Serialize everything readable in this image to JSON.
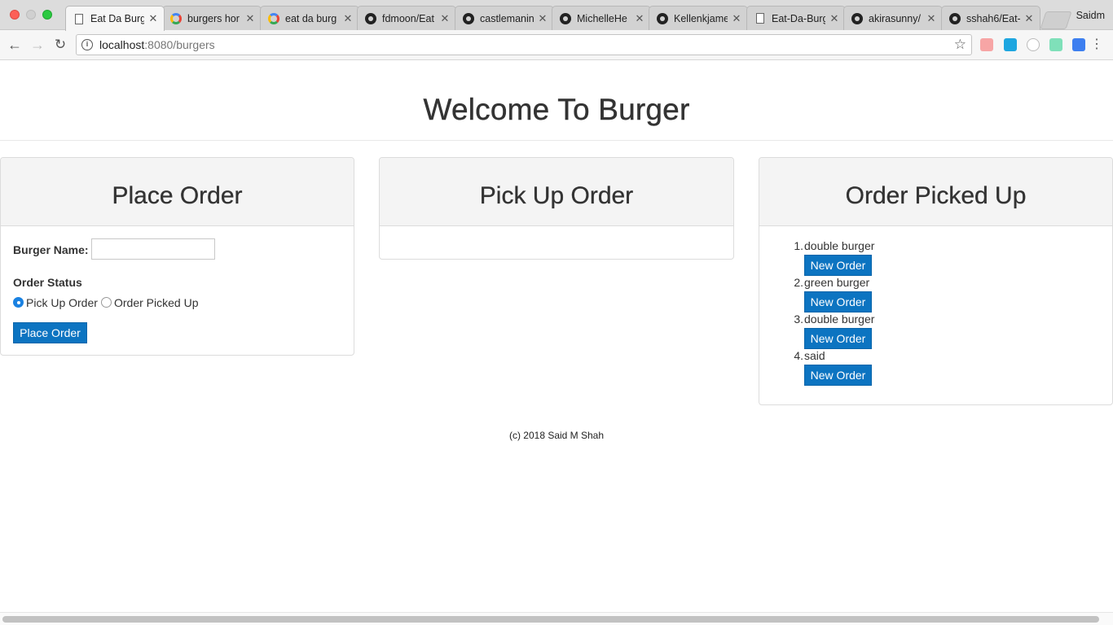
{
  "browser": {
    "tabs": [
      {
        "title": "Eat Da Burg",
        "icon": "doc-icon",
        "active": true
      },
      {
        "title": "burgers hor",
        "icon": "google-icon"
      },
      {
        "title": "eat da burg",
        "icon": "google-icon"
      },
      {
        "title": "fdmoon/Eat",
        "icon": "github-icon"
      },
      {
        "title": "castlemanin",
        "icon": "github-icon"
      },
      {
        "title": "MichelleHe",
        "icon": "github-icon"
      },
      {
        "title": "Kellenkjame",
        "icon": "github-icon"
      },
      {
        "title": "Eat-Da-Burg",
        "icon": "doc-icon"
      },
      {
        "title": "akirasunny/",
        "icon": "github-icon"
      },
      {
        "title": "sshah6/Eat-",
        "icon": "github-icon"
      }
    ],
    "close_glyph": "✕",
    "profile_name": "Saidm",
    "url_host": "localhost",
    "url_path": ":8080/burgers"
  },
  "page": {
    "title": "Welcome To Burger",
    "place_order": {
      "heading": "Place Order",
      "burger_name_label": "Burger Name:",
      "burger_name_value": "",
      "order_status_label": "Order Status",
      "option_pickup": "Pick Up Order",
      "option_picked": "Order Picked Up",
      "selected_option": "Pick Up Order",
      "submit_label": "Place Order"
    },
    "pick_up_order": {
      "heading": "Pick Up Order",
      "items": []
    },
    "order_picked_up": {
      "heading": "Order Picked Up",
      "items": [
        {
          "number": "1.",
          "name": "double burger",
          "button": "New Order"
        },
        {
          "number": "2.",
          "name": "green burger",
          "button": "New Order"
        },
        {
          "number": "3.",
          "name": "double burger",
          "button": "New Order"
        },
        {
          "number": "4.",
          "name": "said",
          "button": "New Order"
        }
      ]
    },
    "footer": "(c) 2018 Said M Shah"
  },
  "colors": {
    "button_blue": "#0c74c1",
    "panel_heading_bg": "#f4f4f4",
    "radio_checked": "#1a82e2"
  }
}
